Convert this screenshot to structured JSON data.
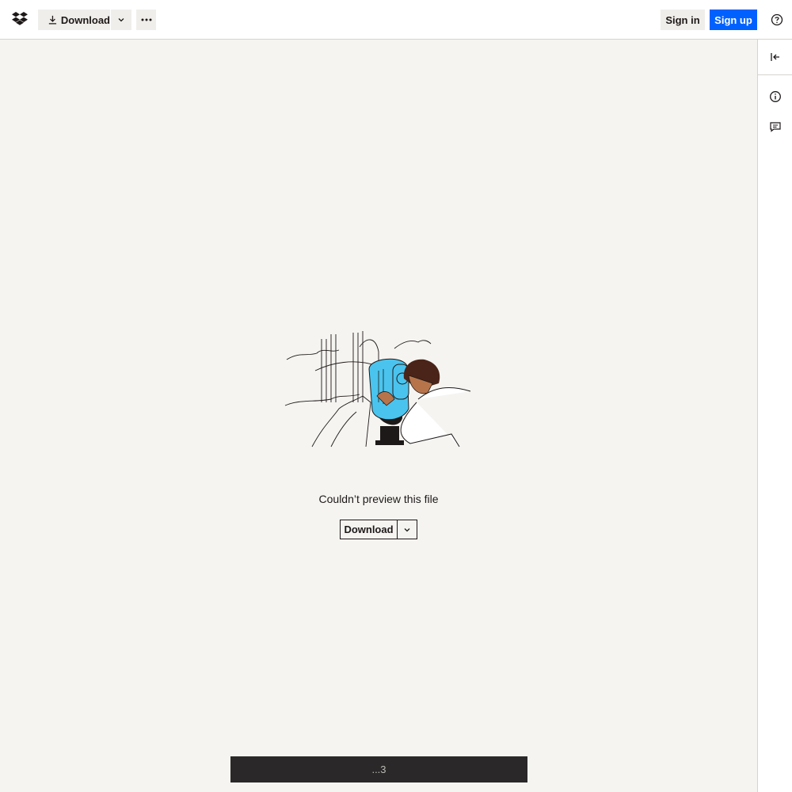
{
  "header": {
    "logo_icon": "dropbox-logo-icon",
    "download_label": "Download",
    "download_icon": "download-icon",
    "chevron_icon": "chevron-down-icon",
    "more_icon": "more-horizontal-icon",
    "signin_label": "Sign in",
    "signup_label": "Sign up",
    "help_icon": "help-icon",
    "accent_color": "#0061fe"
  },
  "sidebar": {
    "collapse_icon": "collapse-panel-icon",
    "info_icon": "info-icon",
    "comment_icon": "comment-icon"
  },
  "preview": {
    "illustration": "binoculars-viewer-illustration",
    "message": "Couldn’t preview this file",
    "download_label": "Download"
  },
  "toast": {
    "text": "...3"
  }
}
